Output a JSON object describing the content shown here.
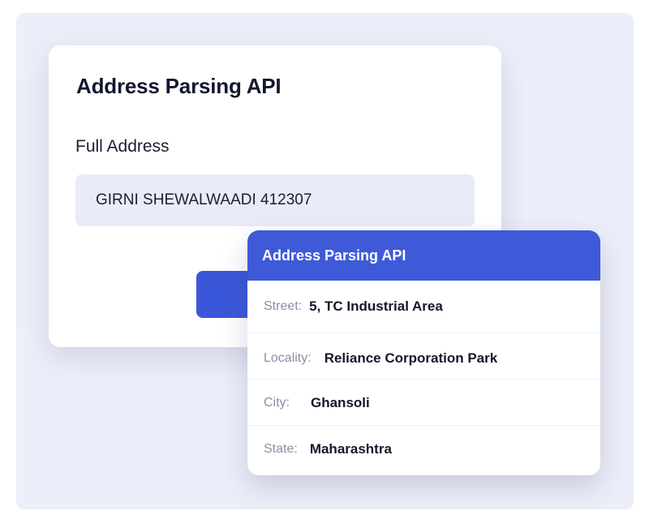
{
  "form": {
    "title": "Address Parsing API",
    "field_label": "Full Address",
    "address_value": "GIRNI SHEWALWAADI 412307"
  },
  "result": {
    "header": "Address Parsing API",
    "rows": [
      {
        "label": "Street:",
        "value": "5, TC Industrial Area"
      },
      {
        "label": "Locality:",
        "value": "Reliance Corporation Park"
      },
      {
        "label": "City:",
        "value": "Ghansoli"
      },
      {
        "label": "State:",
        "value": "Maharashtra"
      }
    ]
  },
  "colors": {
    "accent": "#3f5ad8",
    "background": "#eceef9",
    "input_background": "#e9ebf8"
  }
}
